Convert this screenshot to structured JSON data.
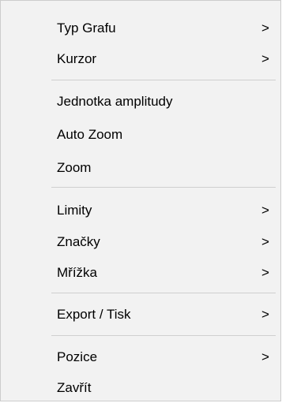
{
  "menu": {
    "items": [
      {
        "label": "Typ Grafu",
        "submenu": true
      },
      {
        "label": "Kurzor",
        "submenu": true
      },
      {
        "label": "Jednotka amplitudy",
        "submenu": false
      },
      {
        "label": "Auto Zoom",
        "submenu": false
      },
      {
        "label": "Zoom",
        "submenu": false
      },
      {
        "label": "Limity",
        "submenu": true
      },
      {
        "label": "Značky",
        "submenu": true
      },
      {
        "label": "Mřížka",
        "submenu": true
      },
      {
        "label": "Export / Tisk",
        "submenu": true
      },
      {
        "label": "Pozice",
        "submenu": true
      },
      {
        "label": "Zavřít",
        "submenu": false
      }
    ],
    "arrow_glyph": ">"
  }
}
